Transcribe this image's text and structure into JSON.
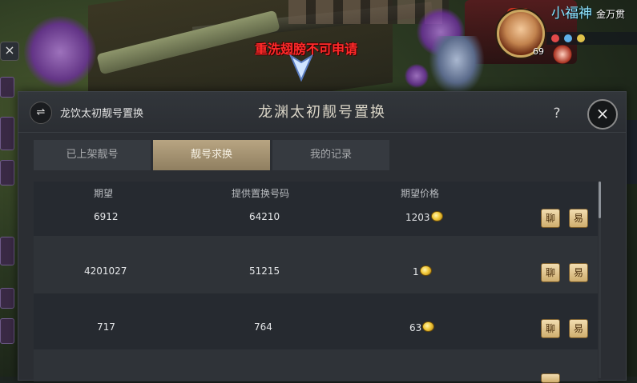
{
  "scene": {
    "notice": "重洗翅膀不可申请"
  },
  "player": {
    "name": "小福神",
    "title": "金万贯",
    "level": "69"
  },
  "left_hud": {
    "close": "×"
  },
  "dialog": {
    "sub_title": "龙饮太初靓号置换",
    "title": "龙渊太初靓号置换",
    "help": "?",
    "close": "×",
    "tabs": [
      {
        "label": "已上架靓号",
        "active": false
      },
      {
        "label": "靓号求换",
        "active": true
      },
      {
        "label": "我的记录",
        "active": false
      }
    ],
    "columns": {
      "expected": "期望",
      "offered": "提供置换号码",
      "price": "期望价格"
    },
    "rows": [
      {
        "expected": "6912",
        "offered": "64210",
        "price": "1203",
        "chat": "聊",
        "trade": "易"
      },
      {
        "expected": "4201027",
        "offered": "51215",
        "price": "1",
        "chat": "聊",
        "trade": "易"
      },
      {
        "expected": "717",
        "offered": "764",
        "price": "63",
        "chat": "聊",
        "trade": "易"
      }
    ]
  },
  "colors": {
    "accent_gold": "#cfae6e",
    "notice_red": "#ff2a2a",
    "name_cyan": "#8fe3ff"
  }
}
